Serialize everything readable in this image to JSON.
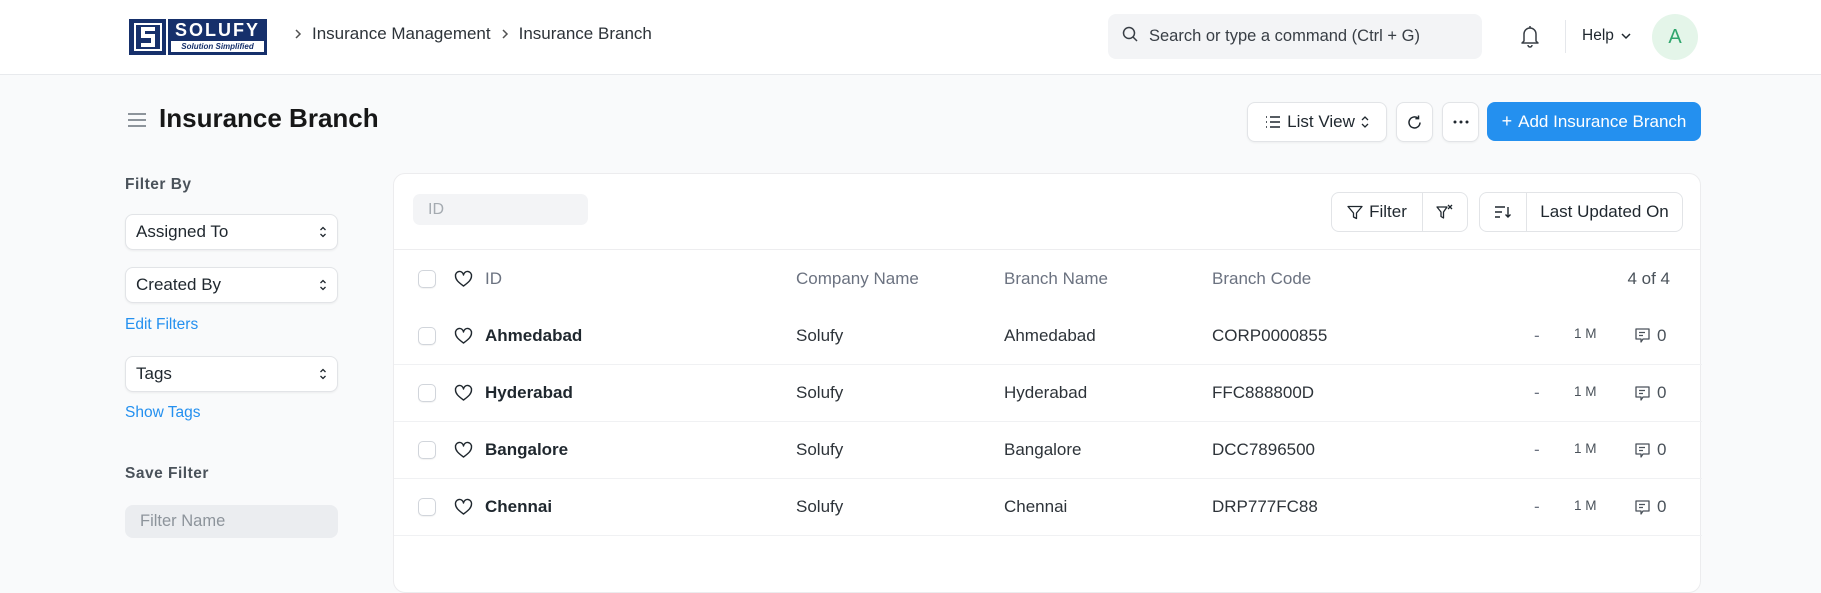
{
  "brand": {
    "name": "SOLUFY",
    "tagline": "Solution Simplified",
    "colors": {
      "primary": "#2490ef",
      "logo_navy": "#16306b"
    }
  },
  "navbar": {
    "breadcrumbs": [
      "Insurance Management",
      "Insurance Branch"
    ],
    "search_placeholder": "Search or type a command (Ctrl + G)",
    "help_label": "Help",
    "avatar_initial": "A"
  },
  "page": {
    "title": "Insurance Branch",
    "view_selector": "List View",
    "more_label": "...",
    "add_button": "Add Insurance Branch"
  },
  "sidebar": {
    "filter_by_heading": "Filter By",
    "filters": [
      {
        "label": "Assigned To"
      },
      {
        "label": "Created By"
      }
    ],
    "edit_filters_link": "Edit Filters",
    "tags_select": "Tags",
    "show_tags_link": "Show Tags",
    "save_filter_heading": "Save Filter",
    "filter_name_placeholder": "Filter Name"
  },
  "list": {
    "id_filter_placeholder": "ID",
    "filter_button": "Filter",
    "sort_field": "Last Updated On",
    "columns": {
      "id": "ID",
      "company": "Company Name",
      "branch": "Branch Name",
      "code": "Branch Code"
    },
    "count": "4 of 4",
    "rows": [
      {
        "id": "Ahmedabad",
        "company": "Solufy",
        "branch": "Ahmedabad",
        "code": "CORP0000855",
        "assigned": "-",
        "modified": "1 M",
        "comments": "0"
      },
      {
        "id": "Hyderabad",
        "company": "Solufy",
        "branch": "Hyderabad",
        "code": "FFC888800D",
        "assigned": "-",
        "modified": "1 M",
        "comments": "0"
      },
      {
        "id": "Bangalore",
        "company": "Solufy",
        "branch": "Bangalore",
        "code": "DCC7896500",
        "assigned": "-",
        "modified": "1 M",
        "comments": "0"
      },
      {
        "id": "Chennai",
        "company": "Solufy",
        "branch": "Chennai",
        "code": "DRP777FC88",
        "assigned": "-",
        "modified": "1 M",
        "comments": "0"
      }
    ]
  }
}
